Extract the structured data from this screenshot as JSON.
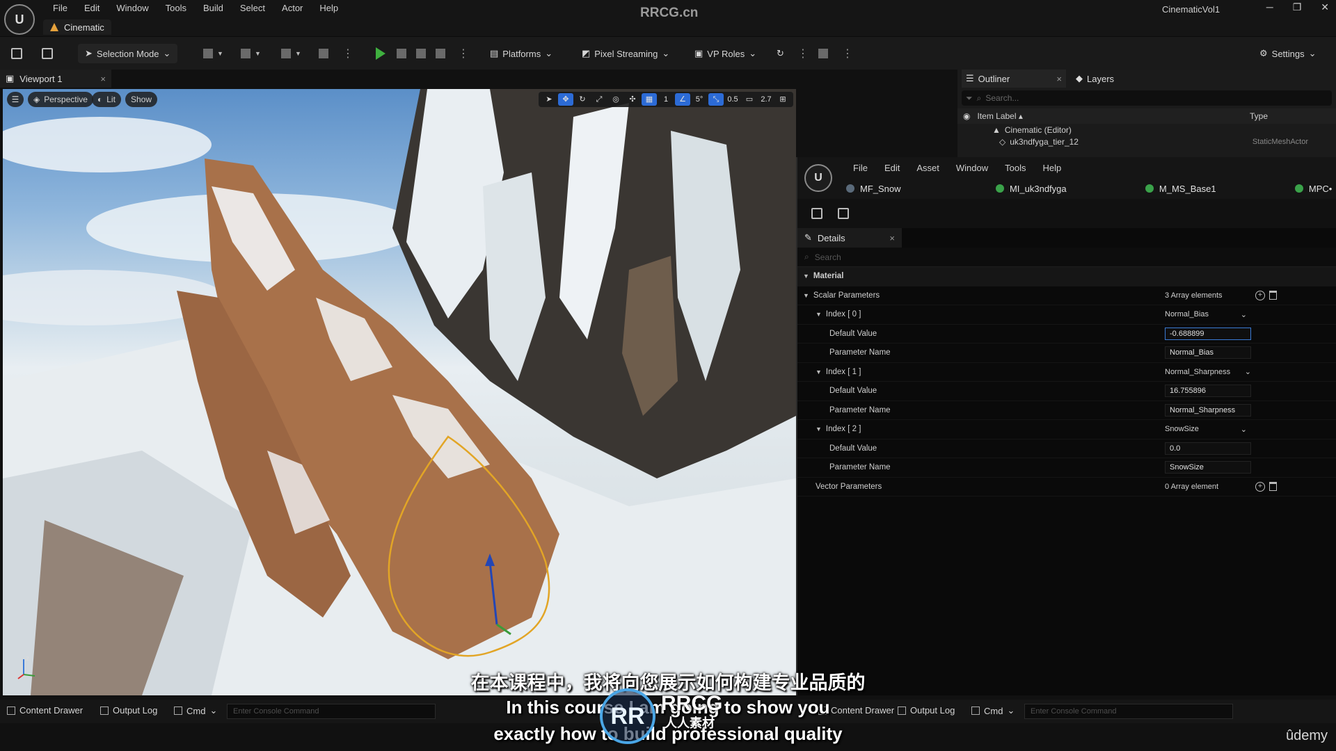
{
  "window": {
    "menu": [
      "File",
      "Edit",
      "Window",
      "Tools",
      "Build",
      "Select",
      "Actor",
      "Help"
    ],
    "project_tab": "Cinematic",
    "site_title": "RRCG.cn",
    "project_name": "CinematicVol1",
    "controls": {
      "minimize": "─",
      "restore": "❐",
      "close": "✕"
    }
  },
  "toolbar": {
    "selection_mode": "Selection Mode",
    "platforms": "Platforms",
    "pixel_streaming": "Pixel Streaming",
    "vp_roles": "VP Roles",
    "settings": "Settings"
  },
  "viewport": {
    "tab_label": "Viewport 1",
    "close": "×",
    "perspective": "Perspective",
    "lit": "Lit",
    "show": "Show",
    "grid_value": "1",
    "angle_value": "5°",
    "scale_value": "0.5",
    "camera_speed": "2.7",
    "axis_z": "z"
  },
  "outliner": {
    "tab_label": "Outliner",
    "close": "×",
    "layers_label": "Layers",
    "search_placeholder": "Search...",
    "col_item_label": "Item Label ▴",
    "col_type": "Type",
    "rows": [
      {
        "label": "Cinematic (Editor)",
        "type": ""
      },
      {
        "label": "uk3ndfyga_tier_12",
        "type": "StaticMeshActor"
      }
    ]
  },
  "material_editor": {
    "menu": [
      "File",
      "Edit",
      "Asset",
      "Window",
      "Tools",
      "Help"
    ],
    "tabs": [
      "MF_Snow",
      "MI_uk3ndfyga",
      "M_MS_Base1",
      "MPC•"
    ],
    "details_label": "Details",
    "details_close": "×",
    "search_placeholder": "Search",
    "material_section": "Material",
    "scalar_params": {
      "label": "Scalar Parameters",
      "value": "3 Array elements"
    },
    "indices": [
      {
        "label": "Index [ 0 ]",
        "name_dd": "Normal_Bias",
        "default_label": "Default Value",
        "default_value": "-0.688899",
        "param_label": "Parameter Name",
        "param_value": "Normal_Bias"
      },
      {
        "label": "Index [ 1 ]",
        "name_dd": "Normal_Sharpness",
        "default_label": "Default Value",
        "default_value": "16.755896",
        "param_label": "Parameter Name",
        "param_value": "Normal_Sharpness"
      },
      {
        "label": "Index [ 2 ]",
        "name_dd": "SnowSize",
        "default_label": "Default Value",
        "default_value": "0.0",
        "param_label": "Parameter Name",
        "param_value": "SnowSize"
      }
    ],
    "vector_params": {
      "label": "Vector Parameters",
      "value": "0 Array element"
    }
  },
  "bottombar": {
    "content_drawer": "Content Drawer",
    "output_log": "Output Log",
    "cmd": "Cmd",
    "console_placeholder": "Enter Console Command",
    "content_drawer_2": "Content Drawer",
    "output_log_2": "Output Log",
    "cmd_2": "Cmd",
    "console_placeholder_2": "Enter Console Command"
  },
  "subtitles": {
    "chinese": "在本课程中，我将向您展示如何构建专业品质的",
    "english_line1": "In this course I am going to show you",
    "english_line2": "exactly how to build professional quality"
  },
  "watermark": {
    "logo": "RR",
    "text": "RRCG",
    "subtext": "人人素材"
  },
  "udemy": "ûdemy"
}
